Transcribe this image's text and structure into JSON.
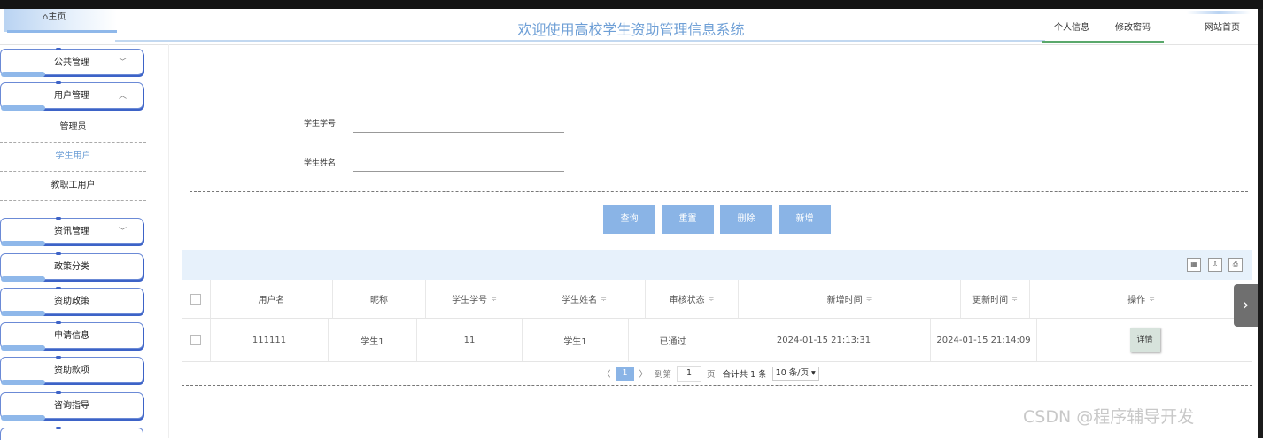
{
  "header": {
    "home_label": "⌂主页",
    "title": "欢迎使用高校学生资助管理信息系统",
    "nav": [
      "个人信息",
      "修改密码",
      "网站首页"
    ]
  },
  "sidebar": {
    "menu1": "公共管理",
    "menu2": "用户管理",
    "sub": [
      "管理员",
      "学生用户",
      "教职工用户"
    ],
    "menu3": "资讯管理",
    "menu4": "政策分类",
    "menu5": "资助政策",
    "menu6": "申请信息",
    "menu7": "资助款项",
    "menu8": "咨询指导",
    "chev_down": "﹀",
    "chev_up": "︿"
  },
  "search": {
    "student_no_label": "学生学号",
    "student_name_label": "学生姓名"
  },
  "actions": [
    "查询",
    "重置",
    "删除",
    "新增"
  ],
  "table": {
    "columns": [
      "用户名",
      "昵称",
      "学生学号",
      "学生姓名",
      "审核状态",
      "新增时间",
      "更新时间",
      "操作"
    ],
    "rows": [
      [
        "111111",
        "学生1",
        "11",
        "学生1",
        "已通过",
        "2024-01-15 21:13:31",
        "2024-01-15 21:14:09",
        "详情"
      ]
    ],
    "sort_glyph": "≑"
  },
  "pager": {
    "prev": "〈",
    "page": "1",
    "next": "〉",
    "goto": "到第",
    "goto_value": "1",
    "page_unit": "页",
    "total": "合计共 1 条",
    "size": "10 条/页 ▾"
  },
  "misc": {
    "side_arrow": "›",
    "watermark": "CSDN @程序辅导开发"
  }
}
